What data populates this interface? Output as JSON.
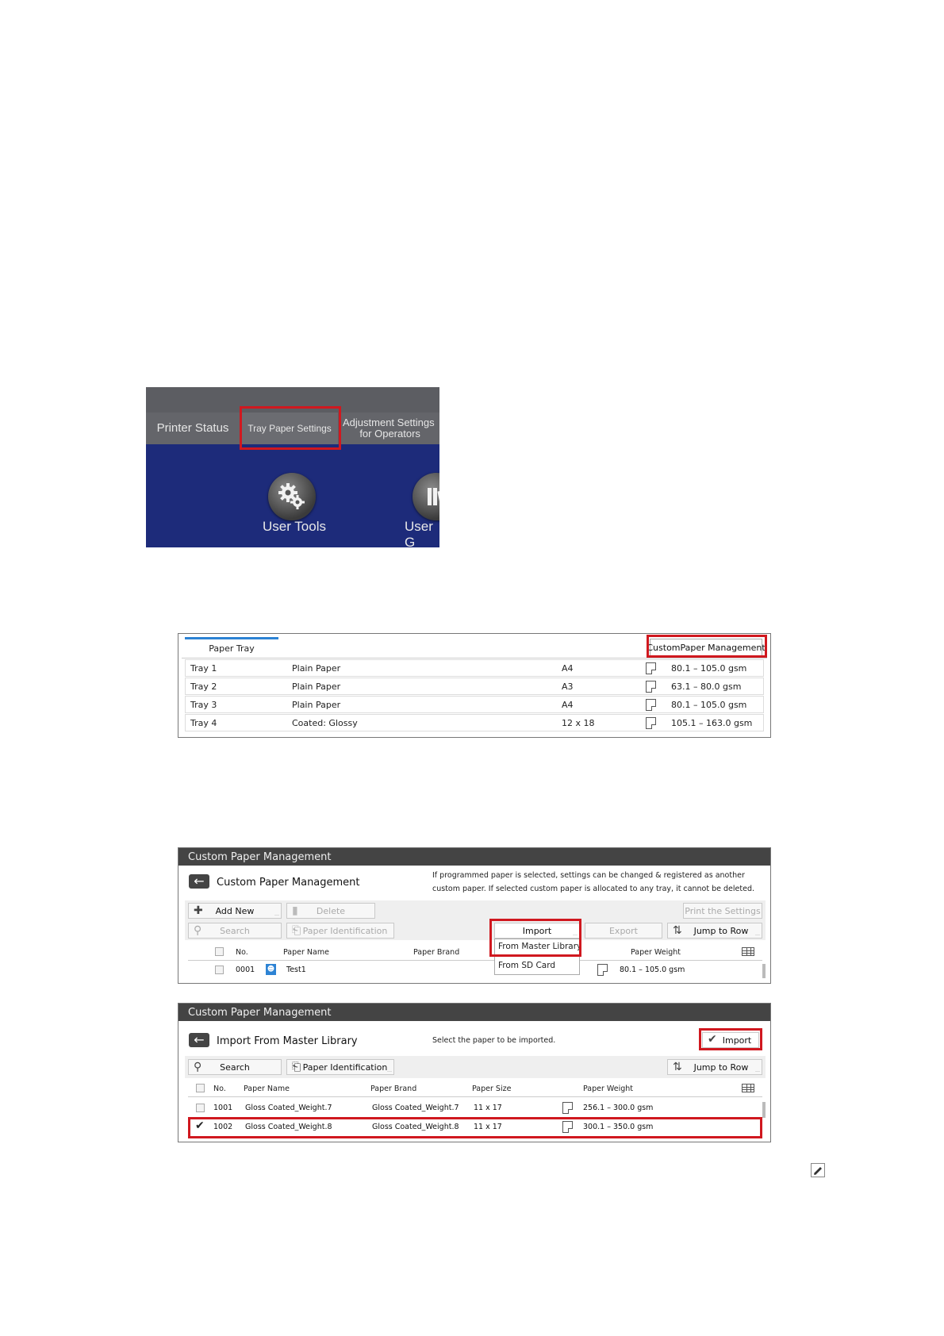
{
  "home_screen": {
    "tabs": [
      "Printer Status",
      "Tray Paper Settings",
      "Adjustment Settings\n for Operators"
    ],
    "icons": [
      {
        "label": "User Tools",
        "icon": "gear-icon"
      },
      {
        "label": "User G",
        "icon": "book-icon"
      }
    ]
  },
  "tray_panel": {
    "tab_label": "Paper Tray",
    "button_label": "CustomPaper Management",
    "rows": [
      {
        "tray": "Tray 1",
        "type": "Plain Paper",
        "size": "A4",
        "weight": "80.1 – 105.0 gsm"
      },
      {
        "tray": "Tray 2",
        "type": "Plain Paper",
        "size": "A3",
        "weight": "63.1 – 80.0 gsm"
      },
      {
        "tray": "Tray 3",
        "type": "Plain Paper",
        "size": "A4",
        "weight": "80.1 – 105.0 gsm"
      },
      {
        "tray": "Tray 4",
        "type": "Coated: Glossy",
        "size": "12 x 18",
        "weight": "105.1 – 163.0 gsm"
      }
    ]
  },
  "cpm_panel": {
    "header": "Custom Paper Management",
    "title": "Custom Paper Management",
    "note_line1": "If programmed paper is selected, settings can be changed & registered as another",
    "note_line2": "custom paper. If selected custom paper is allocated to any tray, it cannot be deleted.",
    "add_new": "Add New",
    "delete": "Delete",
    "print_settings": "Print the Settings",
    "search": "Search",
    "paper_identification": "Paper Identification",
    "import": "Import",
    "export": "Export",
    "jump_to_row": "Jump to Row",
    "dropdown": [
      "From Master Library",
      "From SD Card"
    ],
    "columns": {
      "no": "No.",
      "name": "Paper Name",
      "brand": "Paper Brand",
      "weight": "Paper Weight"
    },
    "rows": [
      {
        "no": "0001",
        "name": "Test1",
        "weight": "80.1 – 105.0 gsm"
      }
    ]
  },
  "import_panel": {
    "header": "Custom Paper Management",
    "title": "Import From Master Library",
    "note": "Select the paper to be imported.",
    "import": "Import",
    "search": "Search",
    "paper_identification": "Paper Identification",
    "jump_to_row": "Jump to Row",
    "columns": {
      "no": "No.",
      "name": "Paper Name",
      "brand": "Paper Brand",
      "size": "Paper Size",
      "weight": "Paper Weight"
    },
    "rows": [
      {
        "no": "1001",
        "name": "Gloss Coated_Weight.7",
        "brand": "Gloss Coated_Weight.7",
        "size": "11 x 17",
        "weight": "256.1 – 300.0 gsm",
        "checked": false
      },
      {
        "no": "1002",
        "name": "Gloss Coated_Weight.8",
        "brand": "Gloss Coated_Weight.8",
        "size": "11 x 17",
        "weight": "300.1 – 350.0 gsm",
        "checked": true
      }
    ]
  },
  "colors": {
    "highlight": "#d0181f",
    "home_background": "#1d2b7a",
    "tab_bar": "#5c5d62",
    "panel_header": "#444444"
  },
  "note_icon": "pencil-note-icon"
}
